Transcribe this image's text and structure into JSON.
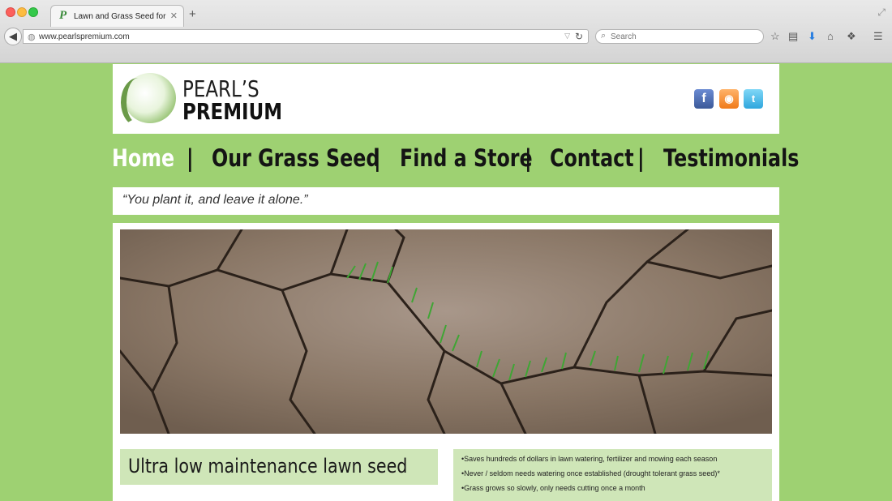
{
  "browser": {
    "tab_title": "Lawn and Grass Seed for ...",
    "tab_close": "✕",
    "new_tab": "+",
    "url": "www.pearlspremium.com",
    "search_placeholder": "Search"
  },
  "site": {
    "logo_line1": "PEARL’S",
    "logo_line2": "PREMIUM",
    "social": {
      "facebook": "f",
      "rss": "◉",
      "twitter": "t"
    },
    "nav": {
      "home": "Home",
      "sep": "|",
      "grass_seed": "Our Grass Seed",
      "find_store": "Find a Store",
      "contact": "Contact",
      "testimonials": "Testimonials"
    },
    "tagline": "“You plant it, and leave it alone.”",
    "headline": "Ultra low maintenance lawn seed",
    "bullets": [
      "•Saves hundreds of dollars in lawn watering, fertilizer and mowing each season",
      "•Never / seldom needs watering once established (drought tolerant grass seed)*",
      "•Grass grows so slowly, only needs cutting once a month"
    ]
  },
  "colors": {
    "page_bg": "#9ed172",
    "panel_green": "#cfe6b8",
    "nav_active": "#ffffff"
  }
}
